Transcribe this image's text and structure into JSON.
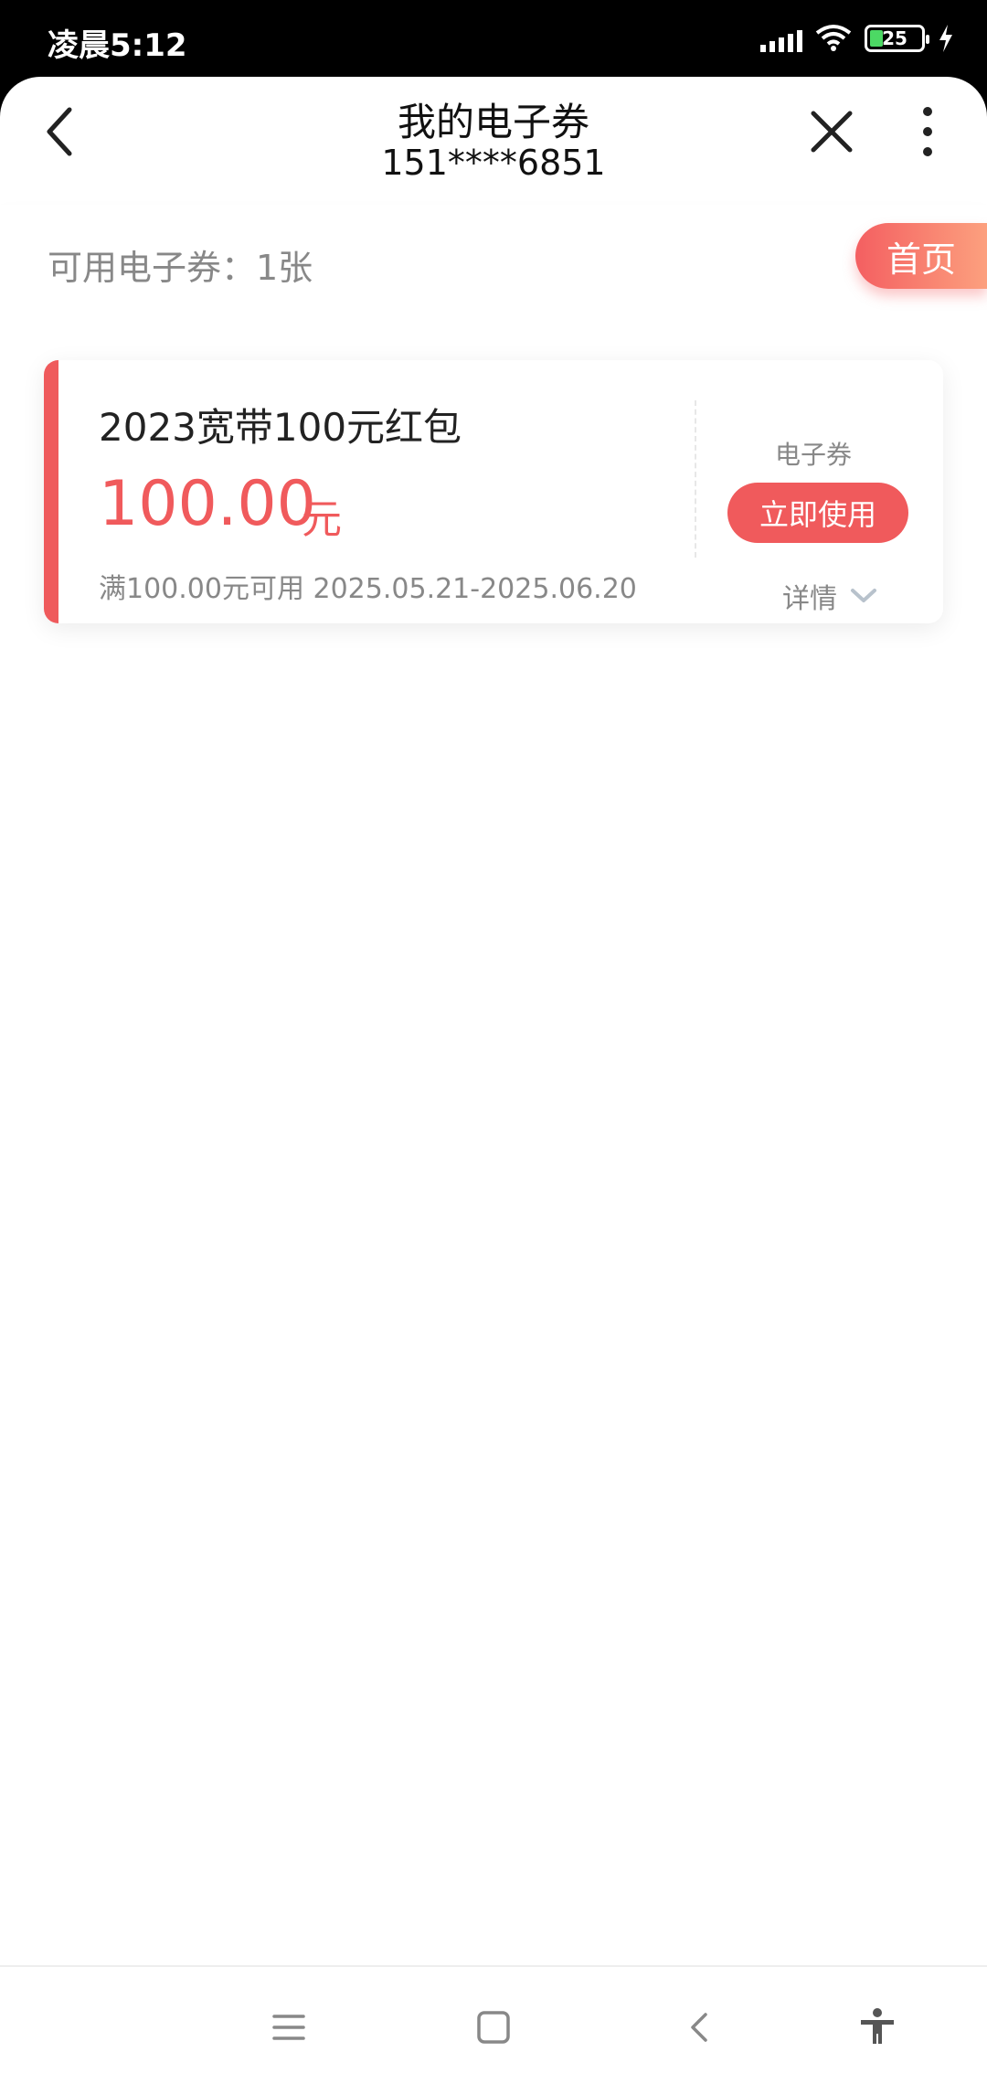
{
  "status_bar": {
    "time": "凌晨5:12",
    "battery_level": "25"
  },
  "header": {
    "title": "我的电子券",
    "subtitle": "151****6851"
  },
  "summary": {
    "available_label": "可用电子券：1张",
    "home_button": "首页"
  },
  "coupon": {
    "name": "2023宽带100元红包",
    "amount": "100.00",
    "unit": "元",
    "condition": "满100.00元可用 2025.05.21-2025.06.20",
    "type": "电子券",
    "use_button": "立即使用",
    "details_label": "详情"
  },
  "icons": {
    "back": "chevron-left-icon",
    "close": "close-icon",
    "more": "more-vertical-icon",
    "menu": "menu-icon",
    "home": "home-icon",
    "nav_back": "back-icon",
    "accessibility": "accessibility-icon"
  },
  "colors": {
    "accent": "#f05a5c",
    "home_gradient_start": "#f45f61",
    "home_gradient_end": "#fca07e"
  }
}
